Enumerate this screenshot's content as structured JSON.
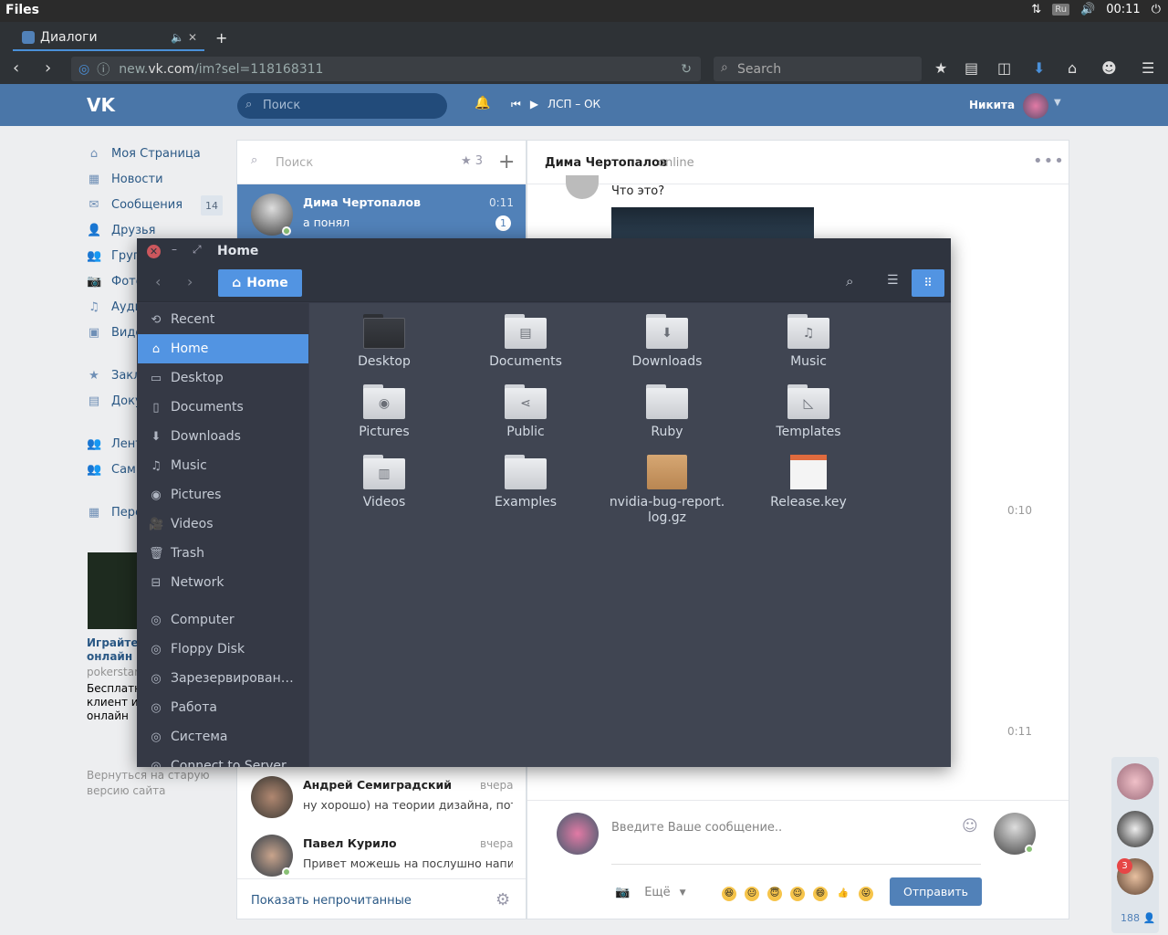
{
  "panel": {
    "title": "Files",
    "lang": "Ru",
    "clock": "00:11"
  },
  "browser": {
    "tab_title": "Диалоги",
    "new_tab": "+",
    "url_prefix": "new.",
    "url_domain": "vk.com",
    "url_path": "/im?sel=118168311",
    "search_placeholder": "Search"
  },
  "vk": {
    "logo": "VK",
    "search_placeholder": "Поиск",
    "player_track": "ЛСП – ОК",
    "user_name": "Никита",
    "menu": [
      {
        "label": "Моя Страница",
        "icon": "home-icon"
      },
      {
        "label": "Новости",
        "icon": "news-icon"
      },
      {
        "label": "Сообщения",
        "icon": "messages-icon"
      },
      {
        "label": "Друзья",
        "icon": "friends-icon"
      },
      {
        "label": "Группы",
        "icon": "groups-icon"
      },
      {
        "label": "Фотографии",
        "icon": "camera-icon"
      },
      {
        "label": "Аудиозаписи",
        "icon": "music-icon"
      },
      {
        "label": "Видеозаписи",
        "icon": "video-icon"
      },
      {
        "label": "Закладки",
        "icon": "star-icon"
      },
      {
        "label": "Документы",
        "icon": "document-icon"
      },
      {
        "label": "Лента",
        "icon": "people-icon"
      },
      {
        "label": "Сами",
        "icon": "people-icon"
      },
      {
        "label": "Перейти",
        "icon": "grid-icon"
      }
    ],
    "messages_badge": "14",
    "ad": {
      "title": "Играйте онлайн",
      "source": "pokerstar",
      "text": "Бесплатн клиент и онлайн"
    },
    "old_site": "Вернуться на старую версию сайта"
  },
  "dialogs": {
    "search_placeholder": "Поиск",
    "starred_count": "3",
    "rows": [
      {
        "name": "Дима Чертопалов",
        "message": "а понял",
        "time": "0:11",
        "unread": "1"
      },
      {
        "name": "Андрей Семиградский",
        "message": "ну хорошо) на теории дизайна, пото...",
        "time": "вчера"
      },
      {
        "name": "Павел Курило",
        "message": "Привет можешь на послушно напис...",
        "time": "вчера"
      }
    ],
    "footer": "Показать непрочитанные"
  },
  "chat": {
    "name": "Дима Чертопалов",
    "status": "online",
    "message": "Что это?",
    "time1": "0:10",
    "time2": "0:11",
    "input_placeholder": "Введите Ваше сообщение..",
    "more": "Ещё",
    "send": "Отправить"
  },
  "right_bar": {
    "badge": "3",
    "count": "188"
  },
  "files": {
    "title": "Home",
    "path_button": "Home",
    "sidebar": [
      {
        "label": "Recent",
        "icon": "clock-icon"
      },
      {
        "label": "Home",
        "icon": "home-icon",
        "active": true
      },
      {
        "label": "Desktop",
        "icon": "desktop-folder-icon"
      },
      {
        "label": "Documents",
        "icon": "document-icon"
      },
      {
        "label": "Downloads",
        "icon": "download-icon"
      },
      {
        "label": "Music",
        "icon": "music-icon"
      },
      {
        "label": "Pictures",
        "icon": "camera-icon"
      },
      {
        "label": "Videos",
        "icon": "video-icon"
      },
      {
        "label": "Trash",
        "icon": "trash-icon"
      },
      {
        "label": "Network",
        "icon": "network-icon"
      },
      {
        "label": "Computer",
        "icon": "drive-icon"
      },
      {
        "label": "Floppy Disk",
        "icon": "drive-icon"
      },
      {
        "label": "Зарезервирован…",
        "icon": "drive-icon"
      },
      {
        "label": "Работа",
        "icon": "drive-icon"
      },
      {
        "label": "Система",
        "icon": "drive-icon"
      },
      {
        "label": "Connect to Server",
        "icon": "drive-icon"
      }
    ],
    "items": [
      {
        "label": "Desktop",
        "icon": "desktop-folder-icon"
      },
      {
        "label": "Documents",
        "icon": "documents-folder-icon"
      },
      {
        "label": "Downloads",
        "icon": "downloads-folder-icon"
      },
      {
        "label": "Music",
        "icon": "music-folder-icon"
      },
      {
        "label": "Pictures",
        "icon": "pictures-folder-icon"
      },
      {
        "label": "Public",
        "icon": "public-folder-icon"
      },
      {
        "label": "Ruby",
        "icon": "folder-icon"
      },
      {
        "label": "Templates",
        "icon": "templates-folder-icon"
      },
      {
        "label": "Videos",
        "icon": "videos-folder-icon"
      },
      {
        "label": "Examples",
        "icon": "examples-folder-icon"
      },
      {
        "label": "nvidia-bug-report.\nlog.gz",
        "icon": "archive-icon"
      },
      {
        "label": "Release.key",
        "icon": "key-file-icon"
      }
    ]
  },
  "colors": {
    "vk_blue": "#4a76a8",
    "accent": "#5294e2",
    "files_bg": "#383c4a"
  }
}
